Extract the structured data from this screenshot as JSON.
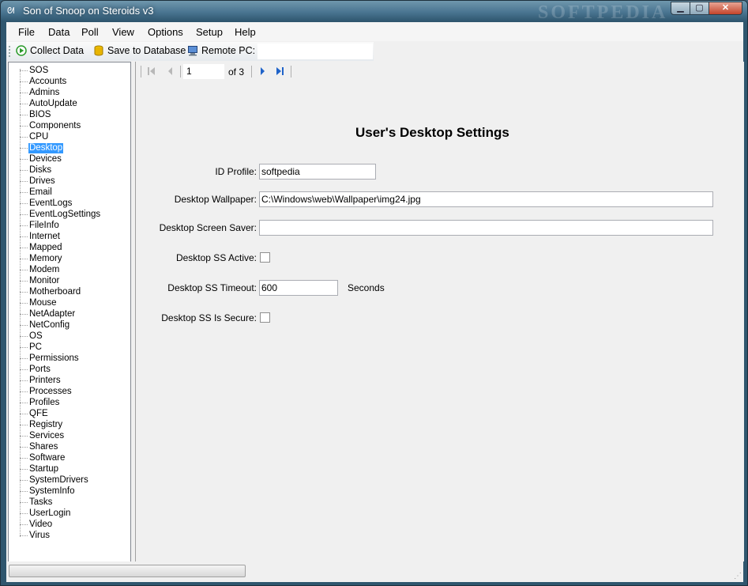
{
  "window": {
    "title": "Son of Snoop on Steroids v3",
    "watermark": "SOFTPEDIA",
    "min_glyph": "▁",
    "max_glyph": "▢",
    "close_glyph": "✕",
    "app_icon_glyph": "ᘛ"
  },
  "menu": [
    "File",
    "Data",
    "Poll",
    "View",
    "Options",
    "Setup",
    "Help"
  ],
  "toolbar": {
    "collect_label": "Collect Data",
    "save_label": "Save to Database",
    "remote_label": "Remote PC:",
    "remote_value": ""
  },
  "tree": {
    "selected": "Desktop",
    "items": [
      "SOS",
      "Accounts",
      "Admins",
      "AutoUpdate",
      "BIOS",
      "Components",
      "CPU",
      "Desktop",
      "Devices",
      "Disks",
      "Drives",
      "Email",
      "EventLogs",
      "EventLogSettings",
      "FileInfo",
      "Internet",
      "Mapped",
      "Memory",
      "Modem",
      "Monitor",
      "Motherboard",
      "Mouse",
      "NetAdapter",
      "NetConfig",
      "OS",
      "PC",
      "Permissions",
      "Ports",
      "Printers",
      "Processes",
      "Profiles",
      "QFE",
      "Registry",
      "Services",
      "Shares",
      "Software",
      "Startup",
      "SystemDrivers",
      "SystemInfo",
      "Tasks",
      "UserLogin",
      "Video",
      "Virus"
    ]
  },
  "navigator": {
    "current_page": "1",
    "of_text": "of 3"
  },
  "form": {
    "heading": "User's Desktop Settings",
    "id_profile_label": "ID Profile:",
    "id_profile_value": "softpedia",
    "wallpaper_label": "Desktop Wallpaper:",
    "wallpaper_value": "C:\\Windows\\web\\Wallpaper\\img24.jpg",
    "screensaver_label": "Desktop Screen Saver:",
    "screensaver_value": "",
    "ss_active_label": "Desktop SS Active:",
    "ss_active_checked": false,
    "ss_timeout_label": "Desktop SS Timeout:",
    "ss_timeout_value": "600",
    "ss_timeout_unit": "Seconds",
    "ss_secure_label": "Desktop SS Is Secure:",
    "ss_secure_checked": false
  },
  "colors": {
    "selection": "#3399ff",
    "titlebar": "#2f566e",
    "play_icon": "#2a9a2a",
    "nav_arrow": "#1f63c9"
  }
}
